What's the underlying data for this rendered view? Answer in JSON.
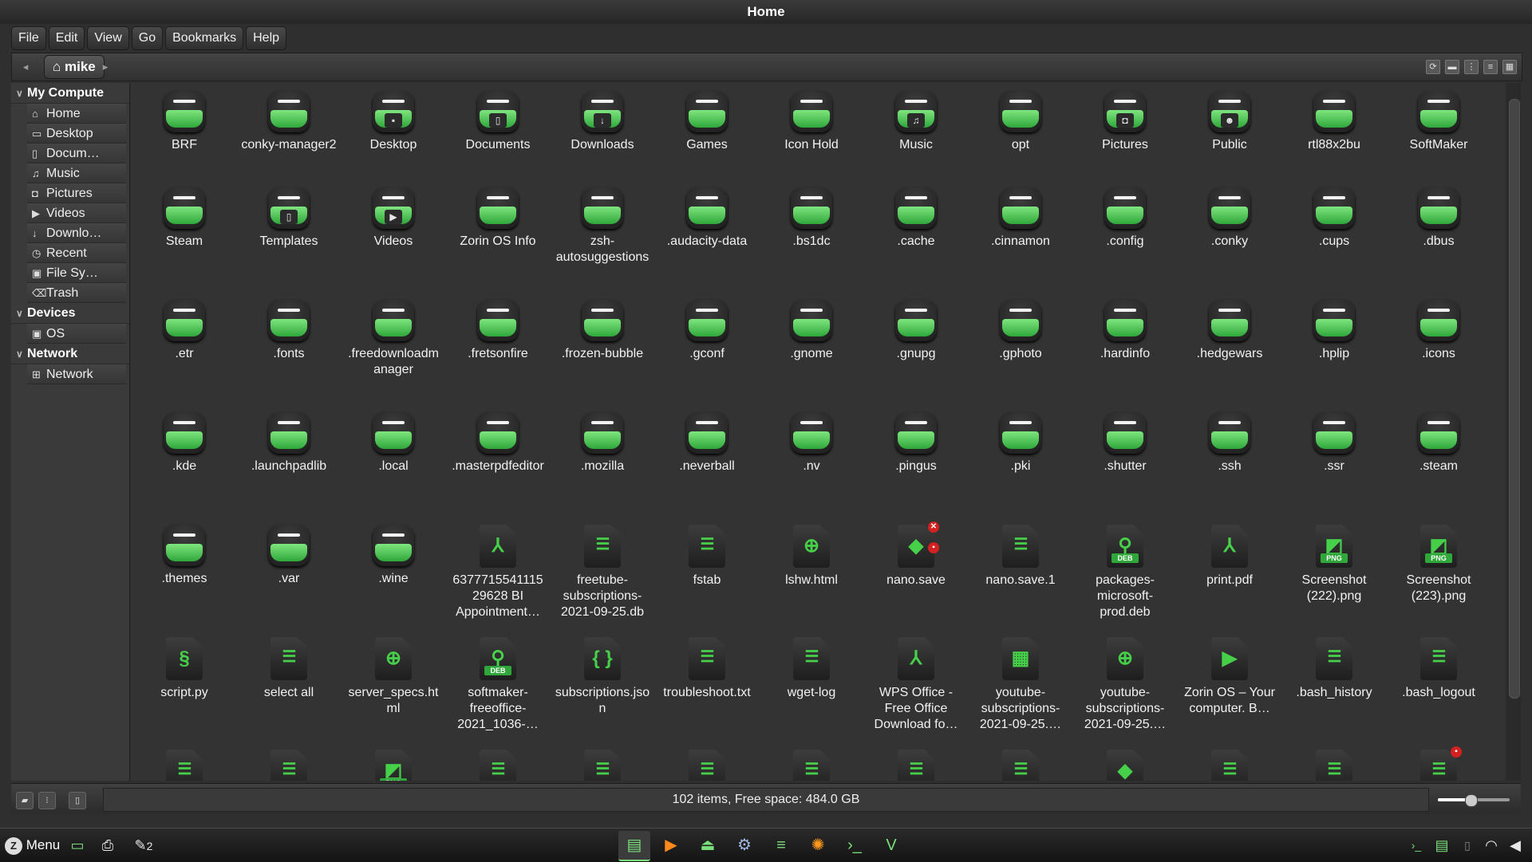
{
  "window": {
    "title": "Home"
  },
  "menu": [
    "File",
    "Edit",
    "View",
    "Go",
    "Bookmarks",
    "Help"
  ],
  "toolbar": {
    "back_icon": "◂",
    "forward_icon": "▸",
    "crumb": "mike"
  },
  "sidebar": {
    "sections": [
      {
        "title": "My Compute",
        "items": [
          {
            "label": "Home",
            "icon": "⌂"
          },
          {
            "label": "Desktop",
            "icon": "▭"
          },
          {
            "label": "Docum…",
            "icon": "▯"
          },
          {
            "label": "Music",
            "icon": "♫"
          },
          {
            "label": "Pictures",
            "icon": "◘"
          },
          {
            "label": "Videos",
            "icon": "▶"
          },
          {
            "label": "Downlo…",
            "icon": "↓"
          },
          {
            "label": "Recent",
            "icon": "◷"
          },
          {
            "label": "File Sy…",
            "icon": "▣"
          },
          {
            "label": "Trash",
            "icon": "⌫"
          }
        ]
      },
      {
        "title": "Devices",
        "items": [
          {
            "label": "OS",
            "icon": "▣"
          }
        ]
      },
      {
        "title": "Network",
        "items": [
          {
            "label": "Network",
            "icon": "⊞"
          }
        ]
      }
    ]
  },
  "files": [
    {
      "name": "BRF",
      "type": "folder",
      "badge": ""
    },
    {
      "name": "conky-manager2",
      "type": "folder",
      "badge": ""
    },
    {
      "name": "Desktop",
      "type": "folder",
      "badge": "▪"
    },
    {
      "name": "Documents",
      "type": "folder",
      "badge": "▯"
    },
    {
      "name": "Downloads",
      "type": "folder",
      "badge": "↓"
    },
    {
      "name": "Games",
      "type": "folder",
      "badge": ""
    },
    {
      "name": "Icon Hold",
      "type": "folder",
      "badge": ""
    },
    {
      "name": "Music",
      "type": "folder",
      "badge": "♫"
    },
    {
      "name": "opt",
      "type": "folder",
      "badge": ""
    },
    {
      "name": "Pictures",
      "type": "folder",
      "badge": "◘"
    },
    {
      "name": "Public",
      "type": "folder",
      "badge": "☻"
    },
    {
      "name": "rtl88x2bu",
      "type": "folder",
      "badge": ""
    },
    {
      "name": "SoftMaker",
      "type": "folder",
      "badge": ""
    },
    {
      "name": "Steam",
      "type": "folder",
      "badge": ""
    },
    {
      "name": "Templates",
      "type": "folder",
      "badge": "▯"
    },
    {
      "name": "Videos",
      "type": "folder",
      "badge": "▶"
    },
    {
      "name": "Zorin OS Info",
      "type": "folder",
      "badge": ""
    },
    {
      "name": "zsh-autosuggestions",
      "type": "folder",
      "badge": ""
    },
    {
      "name": ".audacity-data",
      "type": "folder",
      "badge": ""
    },
    {
      "name": ".bs1dc",
      "type": "folder",
      "badge": ""
    },
    {
      "name": ".cache",
      "type": "folder",
      "badge": ""
    },
    {
      "name": ".cinnamon",
      "type": "folder",
      "badge": ""
    },
    {
      "name": ".config",
      "type": "folder",
      "badge": ""
    },
    {
      "name": ".conky",
      "type": "folder",
      "badge": ""
    },
    {
      "name": ".cups",
      "type": "folder",
      "badge": ""
    },
    {
      "name": ".dbus",
      "type": "folder",
      "badge": ""
    },
    {
      "name": ".etr",
      "type": "folder",
      "badge": ""
    },
    {
      "name": ".fonts",
      "type": "folder",
      "badge": ""
    },
    {
      "name": ".freedownloadmanager",
      "type": "folder",
      "badge": ""
    },
    {
      "name": ".fretsonfire",
      "type": "folder",
      "badge": ""
    },
    {
      "name": ".frozen-bubble",
      "type": "folder",
      "badge": ""
    },
    {
      "name": ".gconf",
      "type": "folder",
      "badge": ""
    },
    {
      "name": ".gnome",
      "type": "folder",
      "badge": ""
    },
    {
      "name": ".gnupg",
      "type": "folder",
      "badge": ""
    },
    {
      "name": ".gphoto",
      "type": "folder",
      "badge": ""
    },
    {
      "name": ".hardinfo",
      "type": "folder",
      "badge": ""
    },
    {
      "name": ".hedgewars",
      "type": "folder",
      "badge": ""
    },
    {
      "name": ".hplip",
      "type": "folder",
      "badge": ""
    },
    {
      "name": ".icons",
      "type": "folder",
      "badge": ""
    },
    {
      "name": ".kde",
      "type": "folder",
      "badge": ""
    },
    {
      "name": ".launchpadlib",
      "type": "folder",
      "badge": ""
    },
    {
      "name": ".local",
      "type": "folder",
      "badge": ""
    },
    {
      "name": ".masterpdfeditor",
      "type": "folder",
      "badge": ""
    },
    {
      "name": ".mozilla",
      "type": "folder",
      "badge": ""
    },
    {
      "name": ".neverball",
      "type": "folder",
      "badge": ""
    },
    {
      "name": ".nv",
      "type": "folder",
      "badge": ""
    },
    {
      "name": ".pingus",
      "type": "folder",
      "badge": ""
    },
    {
      "name": ".pki",
      "type": "folder",
      "badge": ""
    },
    {
      "name": ".shutter",
      "type": "folder",
      "badge": ""
    },
    {
      "name": ".ssh",
      "type": "folder",
      "badge": ""
    },
    {
      "name": ".ssr",
      "type": "folder",
      "badge": ""
    },
    {
      "name": ".steam",
      "type": "folder",
      "badge": ""
    },
    {
      "name": ".themes",
      "type": "folder",
      "badge": ""
    },
    {
      "name": ".var",
      "type": "folder",
      "badge": ""
    },
    {
      "name": ".wine",
      "type": "folder",
      "badge": ""
    },
    {
      "name": "637771554111529628 BI Appointment…",
      "type": "pdf"
    },
    {
      "name": "freetube-subscriptions-2021-09-25.db",
      "type": "text"
    },
    {
      "name": "fstab",
      "type": "text"
    },
    {
      "name": "lshw.html",
      "type": "html"
    },
    {
      "name": "nano.save",
      "type": "package",
      "emblems": [
        "✕",
        "🔒"
      ]
    },
    {
      "name": "nano.save.1",
      "type": "text"
    },
    {
      "name": "packages-microsoft-prod.deb",
      "type": "deb"
    },
    {
      "name": "print.pdf",
      "type": "pdf"
    },
    {
      "name": "Screenshot (222).png",
      "type": "png"
    },
    {
      "name": "Screenshot (223).png",
      "type": "png"
    },
    {
      "name": "script.py",
      "type": "python"
    },
    {
      "name": "select all",
      "type": "text"
    },
    {
      "name": "server_specs.html",
      "type": "html"
    },
    {
      "name": "softmaker-freeoffice-2021_1036-…",
      "type": "deb"
    },
    {
      "name": "subscriptions.json",
      "type": "json"
    },
    {
      "name": "troubleshoot.txt",
      "type": "text"
    },
    {
      "name": "wget-log",
      "type": "text"
    },
    {
      "name": "WPS Office - Free Office Download fo…",
      "type": "pdf"
    },
    {
      "name": "youtube-subscriptions-2021-09-25.…",
      "type": "sheet"
    },
    {
      "name": "youtube-subscriptions-2021-09-25.…",
      "type": "html"
    },
    {
      "name": "Zorin OS – Your computer. B…",
      "type": "video"
    },
    {
      "name": ".bash_history",
      "type": "text"
    },
    {
      "name": ".bash_logout",
      "type": "text"
    },
    {
      "name": "",
      "type": "text"
    },
    {
      "name": "",
      "type": "text"
    },
    {
      "name": "",
      "type": "png"
    },
    {
      "name": "",
      "type": "text"
    },
    {
      "name": "",
      "type": "text"
    },
    {
      "name": "",
      "type": "text"
    },
    {
      "name": "",
      "type": "text"
    },
    {
      "name": "",
      "type": "text"
    },
    {
      "name": "",
      "type": "text"
    },
    {
      "name": "",
      "type": "package"
    },
    {
      "name": "",
      "type": "text"
    },
    {
      "name": "",
      "type": "text"
    },
    {
      "name": "",
      "type": "text",
      "emblems": [
        "🔒"
      ]
    }
  ],
  "statusbar": {
    "text": "102 items, Free space: 484.0 GB",
    "zoom_level": 0.45
  },
  "panel": {
    "menu_label": "Menu",
    "notification_count": "2",
    "launcher_icons": [
      "terminal-icon",
      "printer-icon",
      "notification-icon"
    ],
    "tasks": [
      {
        "name": "files-task",
        "glyph": "▤",
        "color": "#7be07b",
        "active": true
      },
      {
        "name": "media-player-task",
        "glyph": "▶",
        "color": "#ff8a1c"
      },
      {
        "name": "store-task",
        "glyph": "⏏",
        "color": "#7be07b"
      },
      {
        "name": "settings-task",
        "glyph": "⚙",
        "color": "#9db6e0"
      },
      {
        "name": "text-editor-task",
        "glyph": "≡",
        "color": "#7be07b"
      },
      {
        "name": "browser-task",
        "glyph": "✺",
        "color": "#ff9a1c"
      },
      {
        "name": "terminal-task",
        "glyph": "›_",
        "color": "#7be07b"
      },
      {
        "name": "vivaldi-task",
        "glyph": "V",
        "color": "#7be07b"
      }
    ],
    "tray": [
      "terminal-tray-icon",
      "files-tray-icon",
      "network-icon",
      "wifi-icon",
      "volume-icon"
    ]
  }
}
